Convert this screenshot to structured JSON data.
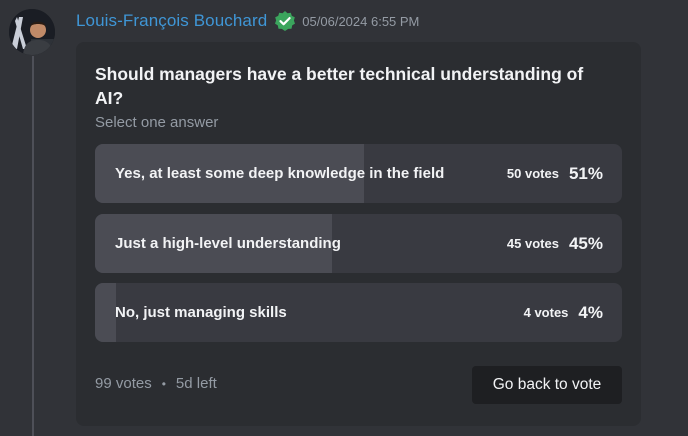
{
  "message": {
    "author": "Louis-François Bouchard",
    "timestamp": "05/06/2024 6:55 PM",
    "avatar": "author-avatar",
    "verified_icon": "verified-check-icon"
  },
  "poll": {
    "question": "Should managers have a better technical understanding of AI?",
    "subtitle": "Select one answer",
    "answers": [
      {
        "label": "Yes, at least some deep knowledge in the field",
        "votes": "50 votes",
        "percent": "51%",
        "share": 0.51
      },
      {
        "label": "Just a high-level understanding",
        "votes": "45 votes",
        "percent": "45%",
        "share": 0.45
      },
      {
        "label": "No, just managing skills",
        "votes": "4 votes",
        "percent": "4%",
        "share": 0.04
      }
    ],
    "total_votes": "99 votes",
    "separator": "•",
    "time_left": "5d left",
    "action_label": "Go back to vote"
  },
  "colors": {
    "background": "#313338",
    "card": "#2b2d31",
    "answer_bg": "#393a41",
    "answer_fill": "#4b4c54",
    "username": "#3f96d6",
    "verified": "#3ba55d",
    "muted_text": "#949ba4"
  }
}
